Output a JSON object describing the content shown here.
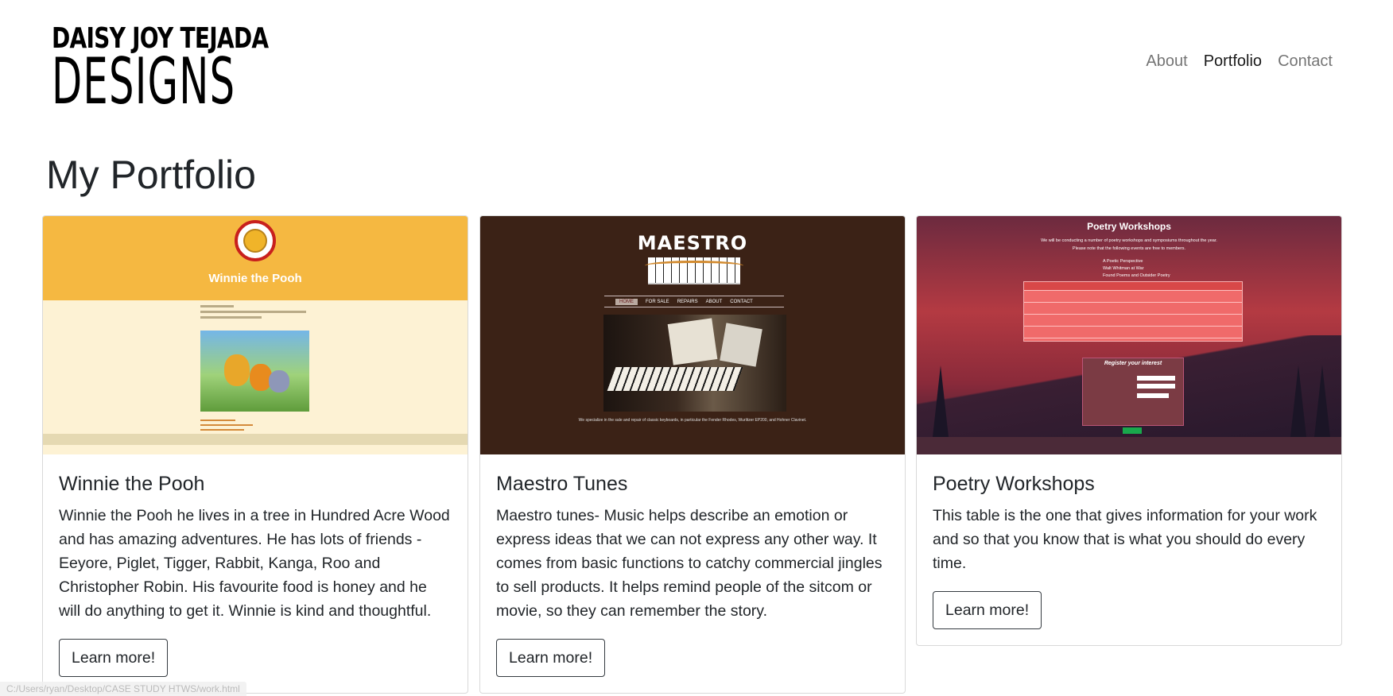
{
  "header": {
    "logo_line1": "DAISY JOY TEJADA",
    "logo_line2": "DESIGNS",
    "nav": {
      "about": "About",
      "portfolio": "Portfolio",
      "contact": "Contact"
    }
  },
  "page_title": "My Portfolio",
  "cards": [
    {
      "title": "Winnie the Pooh",
      "text": "Winnie the Pooh he lives in a tree in Hundred Acre Wood and has amazing adventures. He has lots of friends - Eeyore, Piglet, Tigger, Rabbit, Kanga, Roo and Christopher Robin. His favourite food is honey and he will do anything to get it. Winnie is kind and thoughtful.",
      "button": "Learn more!",
      "thumb": {
        "banner_title": "Winnie the Pooh",
        "accent": "#f5b841",
        "badge_color": "#c8201d"
      }
    },
    {
      "title": "Maestro Tunes",
      "text": "Maestro tunes- Music helps describe an emotion or express ideas that we can not express any other way. It comes from basic functions to catchy commercial jingles to sell products. It helps remind people of the sitcom or movie, so they can remember the story.",
      "button": "Learn more!",
      "thumb": {
        "logo": "MAESTRO",
        "menu": [
          "HOME",
          "FOR SALE",
          "REPAIRS",
          "ABOUT",
          "CONTACT"
        ],
        "caption": "We specialize in the sale and repair of classic keyboards, in particular the Fender Rhodes, Wurlitzer EP200, and Hohner Clavinet.",
        "background": "#3b2216"
      }
    },
    {
      "title": "Poetry Workshops",
      "text": "This table is the one that gives information for your work and so that you know that is what you should do every time.",
      "button": "Learn more!",
      "thumb": {
        "title": "Poetry Workshops",
        "intro1": "We will be conducting a number of poetry workshops and symposiums throughout the year.",
        "intro2": "Please note that the following events are free to members.",
        "list": [
          "A Poetic Perspective",
          "Walt Whitman at War",
          "Found Poems and Outsider Poetry"
        ],
        "form_title": "Register your interest"
      }
    }
  ],
  "status_bar": "C:/Users/ryan/Desktop/CASE STUDY HTWS/work.html"
}
